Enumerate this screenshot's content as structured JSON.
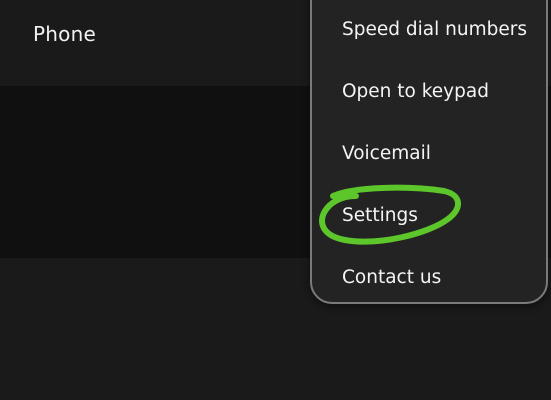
{
  "header": {
    "title": "Phone"
  },
  "overflow_menu": {
    "items": [
      {
        "label": "Speed dial numbers"
      },
      {
        "label": "Open to keypad"
      },
      {
        "label": "Voicemail"
      },
      {
        "label": "Settings"
      },
      {
        "label": "Contact us"
      }
    ]
  },
  "colors": {
    "background": "#1a1a1a",
    "content_band": "#101010",
    "menu_background": "#232323",
    "menu_border": "#7a7a7a",
    "highlight_annotation": "#5cc62b"
  }
}
